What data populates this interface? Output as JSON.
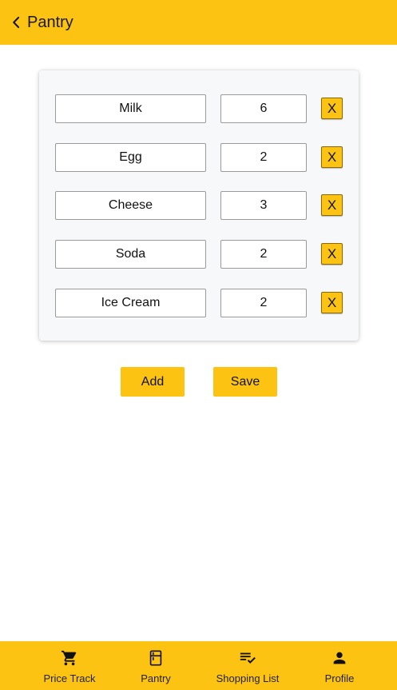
{
  "header": {
    "title": "Pantry",
    "back_icon": "chevron-left-icon"
  },
  "pantry_items": [
    {
      "name": "Milk",
      "quantity": "6",
      "delete_label": "X"
    },
    {
      "name": "Egg",
      "quantity": "2",
      "delete_label": "X"
    },
    {
      "name": "Cheese",
      "quantity": "3",
      "delete_label": "X"
    },
    {
      "name": "Soda",
      "quantity": "2",
      "delete_label": "X"
    },
    {
      "name": "Ice Cream",
      "quantity": "2",
      "delete_label": "X"
    }
  ],
  "actions": {
    "add_label": "Add",
    "save_label": "Save"
  },
  "bottom_nav": {
    "items": [
      {
        "label": "Price Track",
        "icon": "cart-icon"
      },
      {
        "label": "Pantry",
        "icon": "fridge-icon"
      },
      {
        "label": "Shopping List",
        "icon": "checklist-icon"
      },
      {
        "label": "Profile",
        "icon": "person-icon"
      }
    ]
  },
  "colors": {
    "accent": "#fcc313",
    "card_background": "#f7f8fa"
  }
}
